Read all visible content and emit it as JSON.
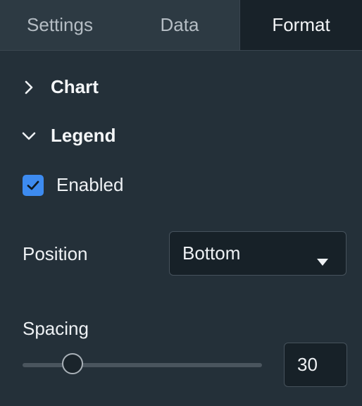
{
  "tabs": [
    {
      "label": "Settings",
      "active": false
    },
    {
      "label": "Data",
      "active": false
    },
    {
      "label": "Format",
      "active": true
    }
  ],
  "sections": {
    "chart": {
      "label": "Chart",
      "expanded": false,
      "icon": "chevron-right-icon"
    },
    "legend": {
      "label": "Legend",
      "expanded": true,
      "icon": "chevron-down-icon"
    }
  },
  "legend": {
    "enabled": {
      "label": "Enabled",
      "checked": true
    },
    "position": {
      "label": "Position",
      "value": "Bottom",
      "icon": "caret-down-icon"
    },
    "spacing": {
      "label": "Spacing",
      "value": "30",
      "slider_fraction": 0.18
    }
  },
  "colors": {
    "background": "#243039",
    "accent": "#3d8bf0",
    "active_tab": "#182229",
    "inactive_tab": "#2d3a43"
  }
}
